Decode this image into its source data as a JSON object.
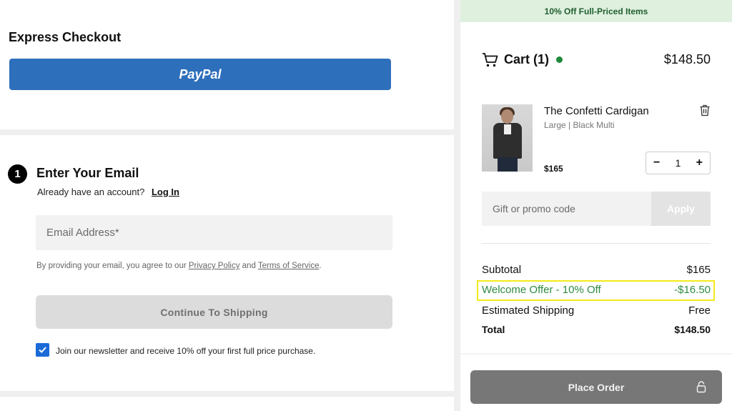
{
  "express": {
    "title": "Express Checkout",
    "paypal_label": "PayPal"
  },
  "email_section": {
    "step_number": "1",
    "title": "Enter Your Email",
    "account_prompt": "Already have an account?",
    "login_link": "Log In",
    "email_placeholder": "Email Address*",
    "legal_prefix": "By providing your email, you agree to our",
    "privacy_link": "Privacy Policy",
    "legal_and": "and",
    "terms_link": "Terms of Service",
    "legal_suffix": ".",
    "continue_label": "Continue To Shipping",
    "newsletter_checked": true,
    "newsletter_label": "Join our newsletter and receive 10% off your first full price purchase."
  },
  "banner": {
    "text": "10% Off Full-Priced Items"
  },
  "cart": {
    "title": "Cart (1)",
    "total": "$148.50",
    "item": {
      "name": "The Confetti Cardigan",
      "variant": "Large | Black Multi",
      "price": "$165",
      "quantity": "1",
      "minus": "−",
      "plus": "+"
    },
    "promo_placeholder": "Gift or promo code",
    "apply_label": "Apply",
    "summary": {
      "subtotal_label": "Subtotal",
      "subtotal_value": "$165",
      "offer_label": "Welcome Offer - 10% Off",
      "offer_value": "-$16.50",
      "shipping_label": "Estimated Shipping",
      "shipping_value": "Free",
      "total_label": "Total",
      "total_value": "$148.50"
    },
    "place_order_label": "Place Order"
  },
  "colors": {
    "paypal": "#2e6fbb",
    "banner_bg": "#dff0df",
    "offer_text": "#2f8a41",
    "highlight": "#f2ea1a",
    "status_dot": "#1e8a3a"
  },
  "icons": {
    "cart": "cart-icon",
    "trash": "trash-icon",
    "lock": "lock-icon",
    "checkbox": "check-icon"
  }
}
